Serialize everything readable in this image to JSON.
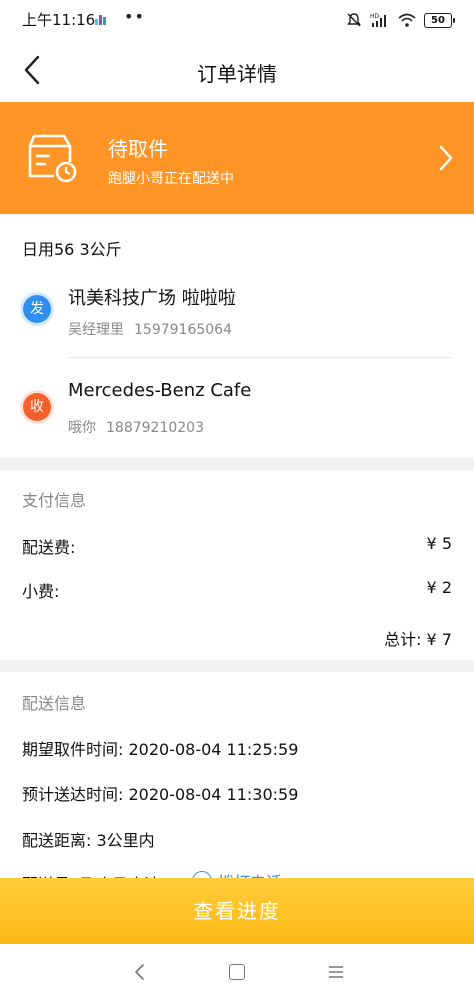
{
  "status_bar": {
    "time": "上午11:16",
    "dots": "••",
    "battery": "50",
    "network": "HD"
  },
  "nav": {
    "title": "订单详情"
  },
  "status_card": {
    "title": "待取件",
    "subtitle": "跑腿小哥正在配送中",
    "color": "#fe9526"
  },
  "order": {
    "goods": "日用56 3公斤",
    "sender": {
      "badge": "发",
      "name": "讯美科技广场 啦啦啦",
      "contact": "吴经理里",
      "phone": "15979165064"
    },
    "receiver": {
      "badge": "收",
      "name": "Mercedes-Benz Cafe",
      "contact": "哦你",
      "phone": "18879210203"
    }
  },
  "payment": {
    "title": "支付信息",
    "fee_label": "配送费:",
    "fee_value": "¥ 5",
    "tip_label": "小费:",
    "tip_value": "¥ 2",
    "total": "总计: ¥ 7"
  },
  "delivery": {
    "title": "配送信息",
    "pickup_time": "期望取件时间: 2020-08-04 11:25:59",
    "arrival_time": "预计送达时间: 2020-08-04 11:30:59",
    "distance": "配送距离: 3公里内",
    "courier": "配送员: 飞小马表达",
    "call_label": "拨打电话"
  },
  "bottom_button": {
    "label": "查看进度"
  }
}
